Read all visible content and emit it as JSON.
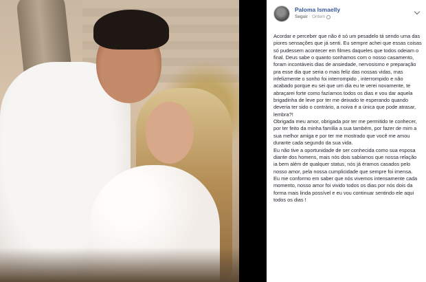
{
  "post": {
    "author": "Paloma Ismaelly",
    "follow": "Seguir",
    "separator": "·",
    "time": "Ontem",
    "paragraphs": [
      "Acordar e perceber que não é só um pesadelo tá sendo uma das piores sensações que já senti. Eu sempre achei que essas coisas só pudessem acontecer em filmes daqueles que todos odeiam o final. Deus sabe o quanto sonhamos com o nosso casamento, foram incontáveis dias de ansiedade, nervosismo e preparação pra esse dia que seria o mais feliz das nossas vidas, mas infelizmente o sonho foi interrompido , interrompido e não acabado porque eu sei que um dia eu te verei novamente, te abraçarei forte como fazíamos todos os dias e vou dar aquela brigadinha de leve por ter me deixado te esperando quando deveria ter sido o contrário, a noiva é a única que pode atrasar, lembra?!",
      "Obrigada meu amor, obrigada por ter me permitido te conhecer, por ter feito da minha família a sua também, por fazer de mim a sua melhor amiga e por ter me mostrado que você me amou durante cada segundo da sua vida.",
      "Eu não tive a oportunidade de ser conhecida como sua esposa diante dos homens, mais nós dois sabíamos que nossa relação ia bem além de qualquer status, nós já éramos casados pelo nosso amor, pela nossa cumplicidade que sempre foi imensa.",
      "Eu me conformo em saber que nós vivemos intensamente cada momento, nosso amor foi vivido todos os dias por nós dois da forma mais linda possível e eu vou continuar sentindo ele aqui todos os dias !"
    ]
  },
  "icons": {
    "avatar": "profile-photo",
    "audience": "globe-icon",
    "menu": "chevron-down-icon"
  }
}
